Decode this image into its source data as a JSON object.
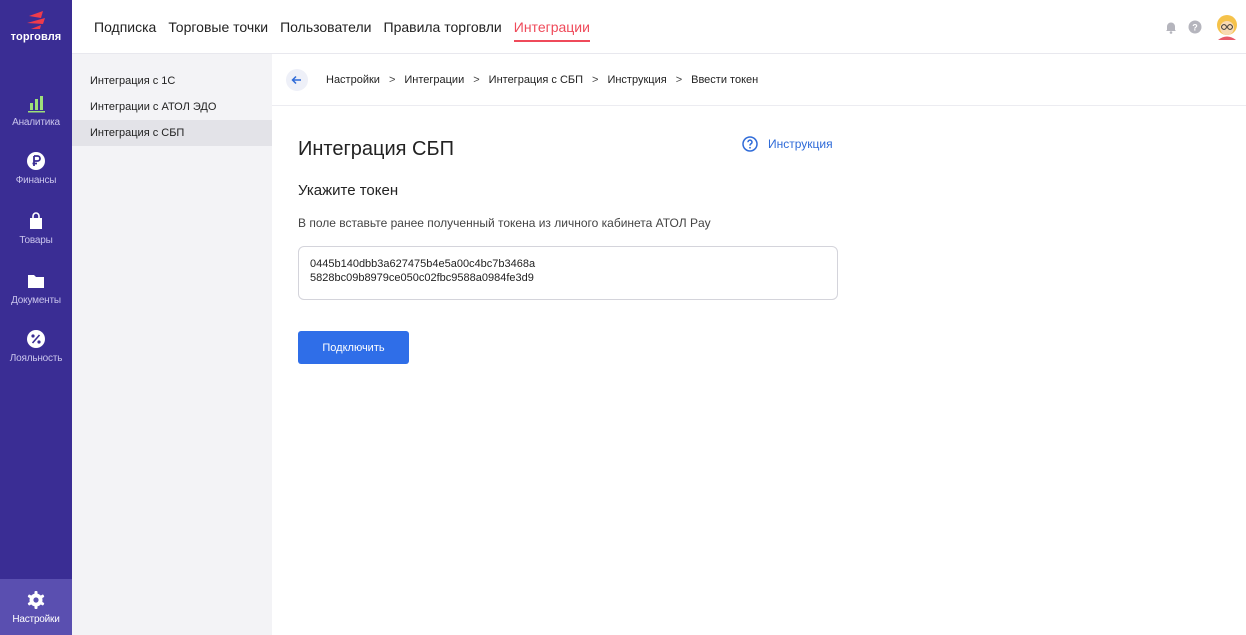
{
  "app": {
    "logo_text": "торговля",
    "accent_color": "#ef4a5a",
    "sidebar_color": "#3a2d94",
    "primary_color": "#2f6ee8"
  },
  "sidebar": {
    "items": [
      {
        "label": "Аналитика",
        "icon": "bar-chart-icon"
      },
      {
        "label": "Финансы",
        "icon": "ruble-coin-icon"
      },
      {
        "label": "Товары",
        "icon": "shopping-bag-icon"
      },
      {
        "label": "Документы",
        "icon": "folder-icon"
      },
      {
        "label": "Лояльность",
        "icon": "percent-badge-icon"
      }
    ],
    "settings": {
      "label": "Настройки",
      "icon": "gear-icon"
    }
  },
  "topbar": {
    "tabs": [
      {
        "label": "Подписка"
      },
      {
        "label": "Торговые точки"
      },
      {
        "label": "Пользователи"
      },
      {
        "label": "Правила торговли"
      },
      {
        "label": "Интеграции",
        "active": true
      }
    ],
    "icons": [
      "bell-icon",
      "help-icon",
      "avatar"
    ]
  },
  "submenu": {
    "items": [
      {
        "label": "Интеграция с 1С"
      },
      {
        "label": "Интеграции с АТОЛ ЭДО"
      },
      {
        "label": "Интеграция с СБП",
        "active": true
      }
    ]
  },
  "breadcrumb": {
    "items": [
      "Настройки",
      "Интеграции",
      "Интеграция с СБП",
      "Инструкция",
      "Ввести токен"
    ],
    "separator": ">"
  },
  "main": {
    "title": "Интеграция СБП",
    "help_link": "Инструкция",
    "subtitle": "Укажите токен",
    "description": "В поле вставьте ранее полученный токена из личного кабинета АТОЛ Pay",
    "token_line_1": "0445b140dbb3a627475b4e5a00c4bc7b3468a",
    "token_line_2": "5828bc09b8979ce050c02fbc9588a0984fe3d9",
    "connect_button": "Подключить"
  }
}
